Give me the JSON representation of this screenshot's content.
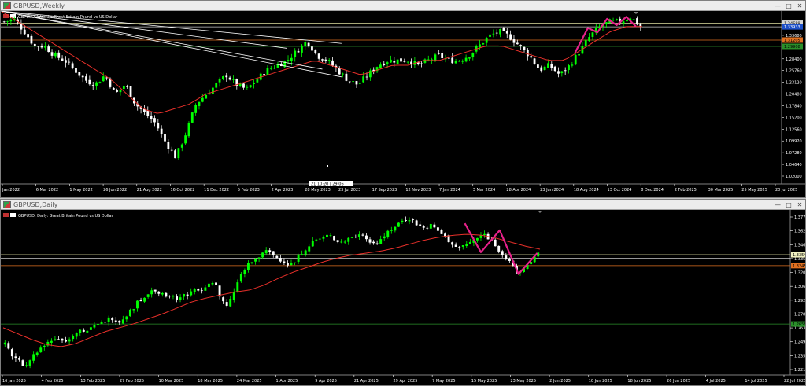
{
  "windows": [
    {
      "id": "weekly",
      "title": "GBPUSD,Weekly",
      "legend": "GBPUSD, Weekly:  Great Britain Pound vs US Dollar",
      "price_labels": [
        "1.36320",
        "1.33680",
        "1.31040",
        "1.28400",
        "1.25760",
        "1.23120",
        "1.20480",
        "1.17840",
        "1.15200",
        "1.12560",
        "1.09920",
        "1.07280",
        "1.04640",
        "1.02000"
      ],
      "price_range": [
        1.015,
        1.372
      ],
      "date_labels": [
        "Jan 2022",
        "6 Mar 2022",
        "1 May 2022",
        "26 Jun 2022",
        "21 Aug 2022",
        "16 Oct 2022",
        "11 Dec 2022",
        "5 Feb 2023",
        "2 Apr 2023",
        "28 May 2023",
        "23 Jul 2023",
        "17 Sep 2023",
        "12 Nov 2023",
        "7 Jan 2024",
        "3 Mar 2024",
        "28 Apr 2024",
        "23 Jun 2024",
        "18 Aug 2024",
        "13 Oct 2024",
        "8 Dec 2024",
        "2 Feb 2025",
        "30 Mar 2025",
        "25 May 2025",
        "20 Jul 2025"
      ],
      "price_tags": [
        {
          "value": 1.3468,
          "label": "1.34689",
          "color": "#d4d4d4",
          "text_color": "#000000"
        },
        {
          "value": 1.3393,
          "label": "1.33933",
          "color": "#1e50c8",
          "text_color": "#ffffff"
        },
        {
          "value": 1.312,
          "label": "1.31205",
          "color": "#e07020",
          "text_color": "#000000"
        },
        {
          "value": 1.299,
          "label": "1.29908",
          "color": "#2a8f2a",
          "text_color": "#000000"
        }
      ],
      "hlines": [
        {
          "value": 1.3468,
          "color": "#e0e0a0"
        },
        {
          "value": 1.3393,
          "color": "#c8c8c8"
        },
        {
          "value": 1.312,
          "color": "#e07020"
        },
        {
          "value": 1.299,
          "color": "#2a8f2a"
        }
      ],
      "period_label": "21 10:20 | 29:06",
      "colors": {
        "bull": "#00ff00",
        "bear": "#ffffff",
        "ma": "#e8302a",
        "pattern": "#e6218a",
        "channel": "#ffffff"
      }
    },
    {
      "id": "daily",
      "title": "GBPUSD,Daily",
      "legend": "GBPUSD, Daily:  Great Britain Pound vs US Dollar",
      "price_labels": [
        "1.37705",
        "1.36280",
        "1.34670",
        "1.33540",
        "1.32045",
        "1.30620",
        "1.29210",
        "1.27800",
        "1.26390",
        "1.24960",
        "1.23550",
        "1.22130"
      ],
      "price_range": [
        1.2145,
        1.3805
      ],
      "date_labels": [
        "16 Jan 2025",
        "4 Feb 2025",
        "13 Feb 2025",
        "27 Feb 2025",
        "10 Mar 2025",
        "18 Mar 2025",
        "24 Mar 2025",
        "1 Apr 2025",
        "9 Apr 2025",
        "21 Apr 2025",
        "29 Apr 2025",
        "7 May 2025",
        "15 May 2025",
        "23 May 2025",
        "2 Jun 2025",
        "10 Jun 2025",
        "18 Jun 2025",
        "26 Jun 2025",
        "4 Jul 2025",
        "14 Jul 2025",
        "22 Jul 2025"
      ],
      "price_tags": [
        {
          "value": 1.3354,
          "label": "1.33540",
          "color": "#f0f0c0",
          "text_color": "#000000"
        },
        {
          "value": 1.3245,
          "label": "1.32453",
          "color": "#e07020",
          "text_color": "#000000"
        },
        {
          "value": 1.2658,
          "label": "1.26580",
          "color": "#2a8f2a",
          "text_color": "#000000"
        }
      ],
      "hlines": [
        {
          "value": 1.3354,
          "color": "#e0e0a0"
        },
        {
          "value": 1.332,
          "color": "#c8c8c8"
        },
        {
          "value": 1.3245,
          "color": "#e07020"
        },
        {
          "value": 1.2658,
          "color": "#2a8f2a"
        }
      ],
      "colors": {
        "bull": "#00ff00",
        "bear": "#ffffff",
        "ma": "#e8302a",
        "pattern": "#e6218a"
      }
    }
  ],
  "chart_data": [
    {
      "type": "candlestick",
      "title": "GBPUSD, Weekly:  Great Britain Pound vs US Dollar",
      "ylim": [
        1.015,
        1.372
      ],
      "close_path": [
        1.35,
        1.355,
        1.33,
        1.3,
        1.3,
        1.28,
        1.27,
        1.25,
        1.23,
        1.22,
        1.24,
        1.2,
        1.22,
        1.18,
        1.16,
        1.14,
        1.1,
        1.07,
        1.12,
        1.18,
        1.2,
        1.22,
        1.24,
        1.22,
        1.21,
        1.23,
        1.25,
        1.26,
        1.27,
        1.29,
        1.31,
        1.28,
        1.27,
        1.25,
        1.23,
        1.22,
        1.24,
        1.26,
        1.27,
        1.27,
        1.27,
        1.26,
        1.27,
        1.28,
        1.27,
        1.27,
        1.28,
        1.3,
        1.32,
        1.33,
        1.32,
        1.3,
        1.28,
        1.25,
        1.26,
        1.24,
        1.26,
        1.29,
        1.32,
        1.34,
        1.35,
        1.35,
        1.36,
        1.34
      ],
      "ma_path": [
        1.37,
        1.35,
        1.33,
        1.31,
        1.29,
        1.27,
        1.25,
        1.23,
        1.2,
        1.17,
        1.16,
        1.17,
        1.18,
        1.2,
        1.21,
        1.22,
        1.23,
        1.24,
        1.25,
        1.26,
        1.27,
        1.26,
        1.25,
        1.24,
        1.25,
        1.26,
        1.26,
        1.27,
        1.27,
        1.28,
        1.29,
        1.3,
        1.3,
        1.29,
        1.28,
        1.27,
        1.27,
        1.29,
        1.31,
        1.33,
        1.34,
        1.34
      ]
    },
    {
      "type": "candlestick",
      "title": "GBPUSD, Daily:  Great Britain Pound vs US Dollar",
      "ylim": [
        1.2145,
        1.3805
      ],
      "close_path": [
        1.245,
        1.235,
        1.228,
        1.225,
        1.232,
        1.24,
        1.245,
        1.25,
        1.252,
        1.248,
        1.255,
        1.26,
        1.258,
        1.262,
        1.265,
        1.27,
        1.272,
        1.268,
        1.275,
        1.282,
        1.29,
        1.295,
        1.3,
        1.298,
        1.295,
        1.292,
        1.293,
        1.296,
        1.3,
        1.298,
        1.305,
        1.31,
        1.29,
        1.282,
        1.3,
        1.315,
        1.325,
        1.33,
        1.335,
        1.34,
        1.333,
        1.33,
        1.325,
        1.328,
        1.338,
        1.345,
        1.35,
        1.352,
        1.355,
        1.35,
        1.348,
        1.352,
        1.354,
        1.356,
        1.35,
        1.345,
        1.355,
        1.36,
        1.365,
        1.37,
        1.372,
        1.366,
        1.362,
        1.365,
        1.36,
        1.354,
        1.348,
        1.342,
        1.344,
        1.348,
        1.352,
        1.356,
        1.35,
        1.342,
        1.334,
        1.325,
        1.316,
        1.322,
        1.33,
        1.336
      ],
      "ma_path": [
        1.262,
        1.256,
        1.25,
        1.245,
        1.243,
        1.246,
        1.252,
        1.258,
        1.262,
        1.266,
        1.271,
        1.276,
        1.282,
        1.288,
        1.292,
        1.295,
        1.298,
        1.3,
        1.305,
        1.312,
        1.318,
        1.323,
        1.328,
        1.332,
        1.335,
        1.337,
        1.339,
        1.342,
        1.346,
        1.35,
        1.353,
        1.355,
        1.356,
        1.355,
        1.352,
        1.348,
        1.344,
        1.341
      ]
    }
  ]
}
